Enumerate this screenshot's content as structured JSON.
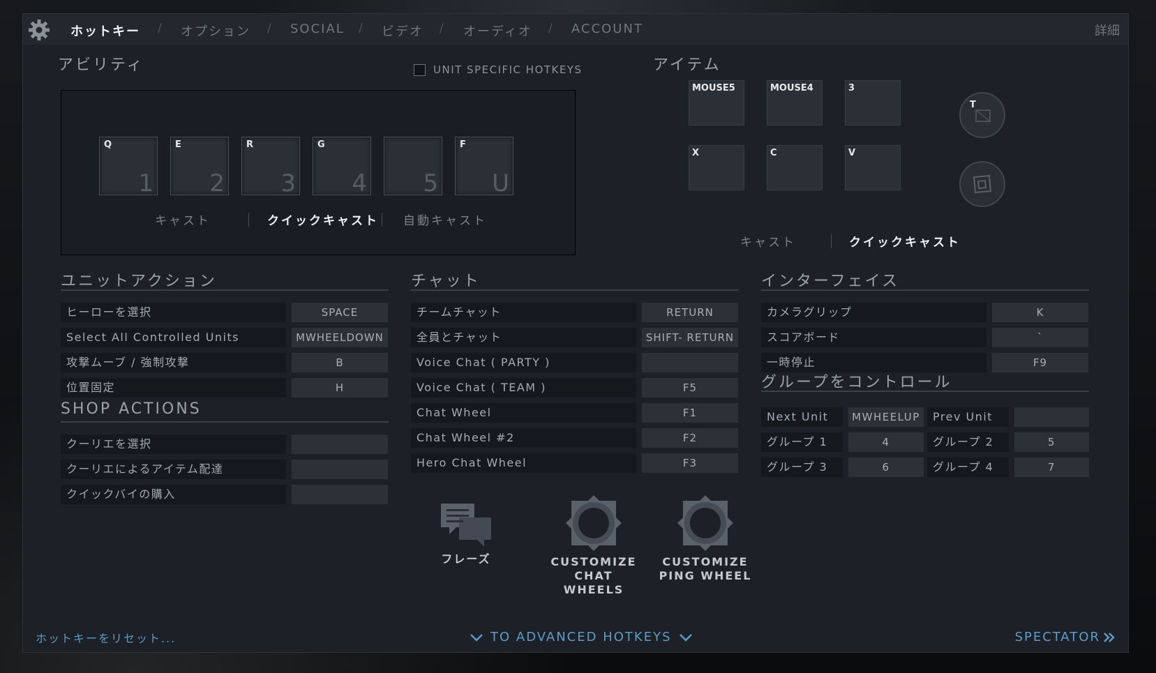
{
  "nav": {
    "tabs": [
      "ホットキー",
      "オプション",
      "SOCIAL",
      "ビデオ",
      "オーディオ",
      "ACCOUNT"
    ],
    "separator": "/",
    "detail": "詳細"
  },
  "abilities": {
    "title": "アビリティ",
    "unit_specific": "UNIT SPECIFIC HOTKEYS",
    "slots": [
      {
        "key": "Q",
        "num": "1"
      },
      {
        "key": "E",
        "num": "2"
      },
      {
        "key": "R",
        "num": "3"
      },
      {
        "key": "G",
        "num": "4"
      },
      {
        "key": "",
        "num": "5"
      },
      {
        "key": "F",
        "num": "U"
      }
    ],
    "cast_modes": [
      "キャスト",
      "クイックキャスト",
      "自動キャスト"
    ]
  },
  "items": {
    "title": "アイテム",
    "slots": [
      {
        "key": "MOUSE5"
      },
      {
        "key": "MOUSE4"
      },
      {
        "key": "3"
      },
      {
        "key": "X"
      },
      {
        "key": "C"
      },
      {
        "key": "V"
      }
    ],
    "special_slots": [
      {
        "key": "T"
      },
      {
        "key": ""
      }
    ],
    "cast_modes": [
      "キャスト",
      "クイックキャスト"
    ]
  },
  "unit_actions": {
    "title": "ユニットアクション",
    "rows": [
      {
        "label": "ヒーローを選択",
        "key": "SPACE"
      },
      {
        "label": "Select All Controlled Units",
        "key": "MWHEELDOWN"
      },
      {
        "label": "攻撃ムーブ / 強制攻撃",
        "key": "B"
      },
      {
        "label": "位置固定",
        "key": "H"
      }
    ]
  },
  "shop_actions": {
    "title": "SHOP ACTIONS",
    "rows": [
      {
        "label": "クーリエを選択",
        "key": ""
      },
      {
        "label": "クーリエによるアイテム配達",
        "key": ""
      },
      {
        "label": "クイックバイの購入",
        "key": ""
      }
    ]
  },
  "chat": {
    "title": "チャット",
    "rows": [
      {
        "label": "チームチャット",
        "key": "RETURN"
      },
      {
        "label": "全員とチャット",
        "key": "SHIFT- RETURN"
      },
      {
        "label": "Voice Chat ( PARTY )",
        "key": ""
      },
      {
        "label": "Voice Chat ( TEAM )",
        "key": "F5"
      },
      {
        "label": "Chat Wheel",
        "key": "F1"
      },
      {
        "label": "Chat Wheel #2",
        "key": "F2"
      },
      {
        "label": "Hero Chat Wheel",
        "key": "F3"
      }
    ],
    "buttons": {
      "phrases": "フレーズ",
      "chat_wheels_1": "CUSTOMIZE",
      "chat_wheels_2": "CHAT WHEELS",
      "ping_wheel_1": "CUSTOMIZE",
      "ping_wheel_2": "PING WHEEL"
    }
  },
  "interface": {
    "title": "インターフェイス",
    "rows": [
      {
        "label": "カメラグリップ",
        "key": "K"
      },
      {
        "label": "スコアボード",
        "key": "`"
      },
      {
        "label": "一時停止",
        "key": "F9"
      }
    ]
  },
  "group_control": {
    "title": "グループをコントロール",
    "rows": [
      [
        {
          "label": "Next Unit",
          "key": "MWHEELUP"
        },
        {
          "label": "Prev Unit",
          "key": ""
        }
      ],
      [
        {
          "label": "グループ 1",
          "key": "4"
        },
        {
          "label": "グループ 2",
          "key": "5"
        }
      ],
      [
        {
          "label": "グループ 3",
          "key": "6"
        },
        {
          "label": "グループ 4",
          "key": "7"
        }
      ]
    ]
  },
  "footer": {
    "reset": "ホットキーをリセット...",
    "advanced": "TO ADVANCED HOTKEYS",
    "spectator": "SPECTATOR"
  },
  "colors": {
    "panel": "#1d2027",
    "accent_blue": "#5a9ec7",
    "active_text": "#f2f4f6"
  }
}
